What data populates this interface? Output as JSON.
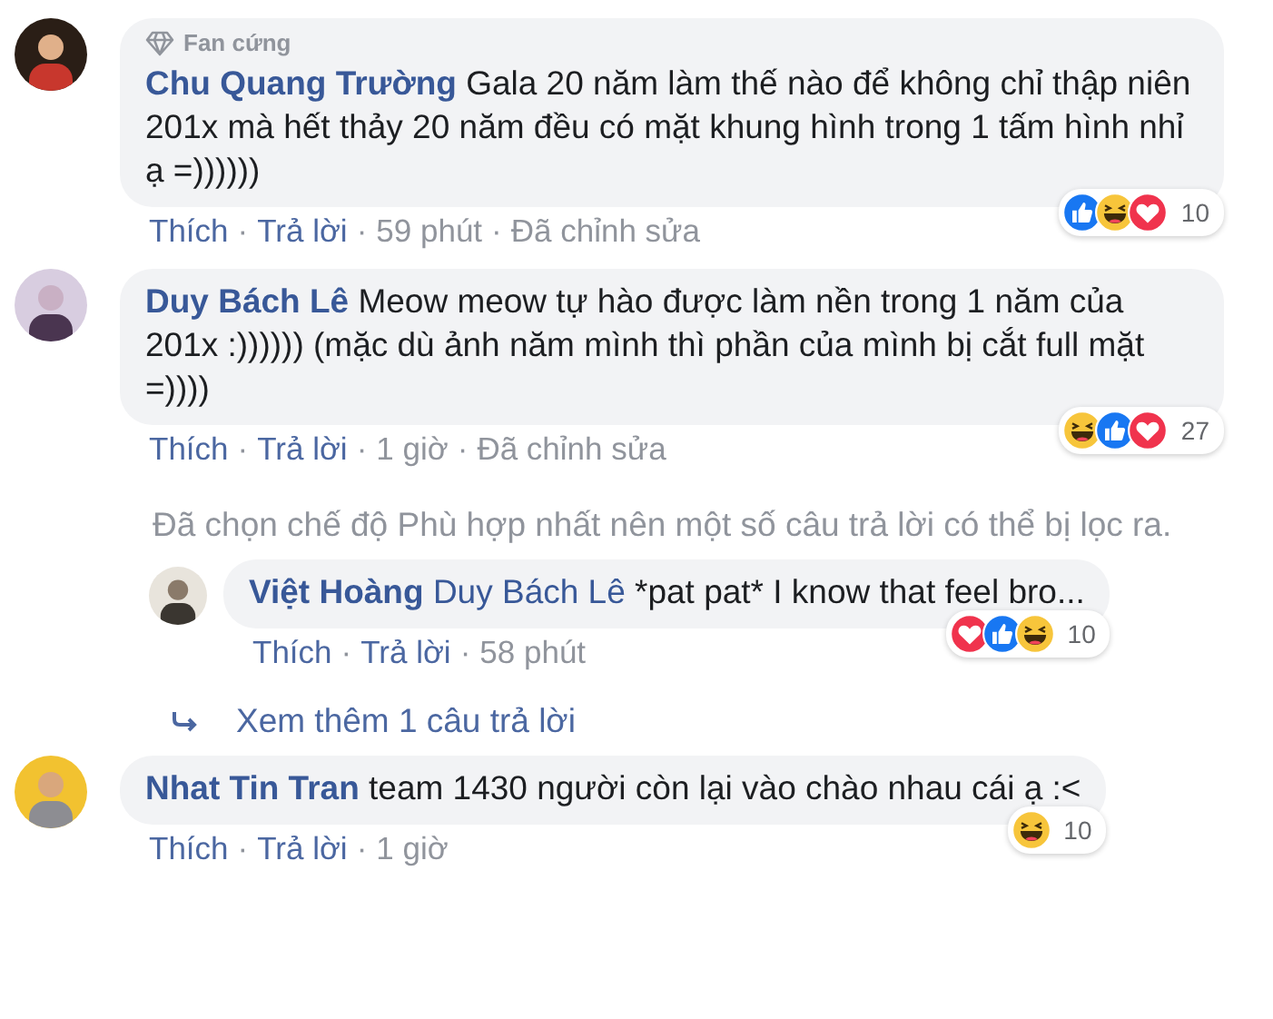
{
  "comments": [
    {
      "kind": "comment",
      "avatar": {
        "kind": "picture"
      },
      "badge": "Fan cứng",
      "author": "Chu Quang Trường",
      "text": "Gala 20 năm làm thế nào để không chỉ thập niên 201x mà hết thảy 20 năm đều có mặt khung hình trong 1 tấm hình nhỉ ạ =))))))",
      "reactions": [
        {
          "kind": "like"
        },
        {
          "kind": "haha"
        },
        {
          "kind": "love"
        }
      ],
      "reaction_count": "10",
      "meta": [
        {
          "kind": "link",
          "text": "Thích"
        },
        {
          "kind": "sep",
          "text": "·"
        },
        {
          "kind": "link",
          "text": "Trả lời"
        },
        {
          "kind": "sep",
          "text": "·"
        },
        {
          "kind": "info",
          "text": "59 phút"
        },
        {
          "kind": "sep",
          "text": "·"
        },
        {
          "kind": "info",
          "text": "Đã chỉnh sửa"
        }
      ]
    },
    {
      "kind": "comment",
      "avatar": {
        "kind": "picture"
      },
      "author": "Duy Bách Lê",
      "text": "Meow meow tự hào được làm nền trong 1 năm của 201x :)))))) (mặc dù ảnh năm mình thì phần của mình bị cắt full mặt =))))",
      "reactions": [
        {
          "kind": "haha"
        },
        {
          "kind": "like"
        },
        {
          "kind": "love"
        }
      ],
      "reaction_count": "27",
      "meta": [
        {
          "kind": "link",
          "text": "Thích"
        },
        {
          "kind": "sep",
          "text": "·"
        },
        {
          "kind": "link",
          "text": "Trả lời"
        },
        {
          "kind": "sep",
          "text": "·"
        },
        {
          "kind": "info",
          "text": "1 giờ"
        },
        {
          "kind": "sep",
          "text": "·"
        },
        {
          "kind": "info",
          "text": "Đã chỉnh sửa"
        }
      ]
    },
    {
      "kind": "notice",
      "text": "Đã chọn chế độ Phù hợp nhất nên một số câu trả lời có thể bị lọc ra."
    },
    {
      "kind": "reply",
      "avatar": {
        "kind": "picture"
      },
      "author": "Việt Hoàng",
      "tag": "Duy Bách Lê",
      "text": "*pat pat* I know that feel bro...",
      "reactions": [
        {
          "kind": "love"
        },
        {
          "kind": "like"
        },
        {
          "kind": "haha"
        }
      ],
      "reaction_count": "10",
      "meta": [
        {
          "kind": "link",
          "text": "Thích"
        },
        {
          "kind": "sep",
          "text": "·"
        },
        {
          "kind": "link",
          "text": "Trả lời"
        },
        {
          "kind": "sep",
          "text": "·"
        },
        {
          "kind": "info",
          "text": "58 phút"
        }
      ]
    },
    {
      "kind": "more",
      "text": "Xem thêm 1 câu trả lời"
    },
    {
      "kind": "comment",
      "avatar": {
        "kind": "picture"
      },
      "author": "Nhat Tin Tran",
      "text": "team 1430 người còn lại vào chào nhau cái ạ :<",
      "reactions": [
        {
          "kind": "haha"
        }
      ],
      "reaction_count": "10",
      "meta": [
        {
          "kind": "link",
          "text": "Thích"
        },
        {
          "kind": "sep",
          "text": "·"
        },
        {
          "kind": "link",
          "text": "Trả lời"
        },
        {
          "kind": "sep",
          "text": "·"
        },
        {
          "kind": "info",
          "text": "1 giờ"
        }
      ]
    }
  ]
}
